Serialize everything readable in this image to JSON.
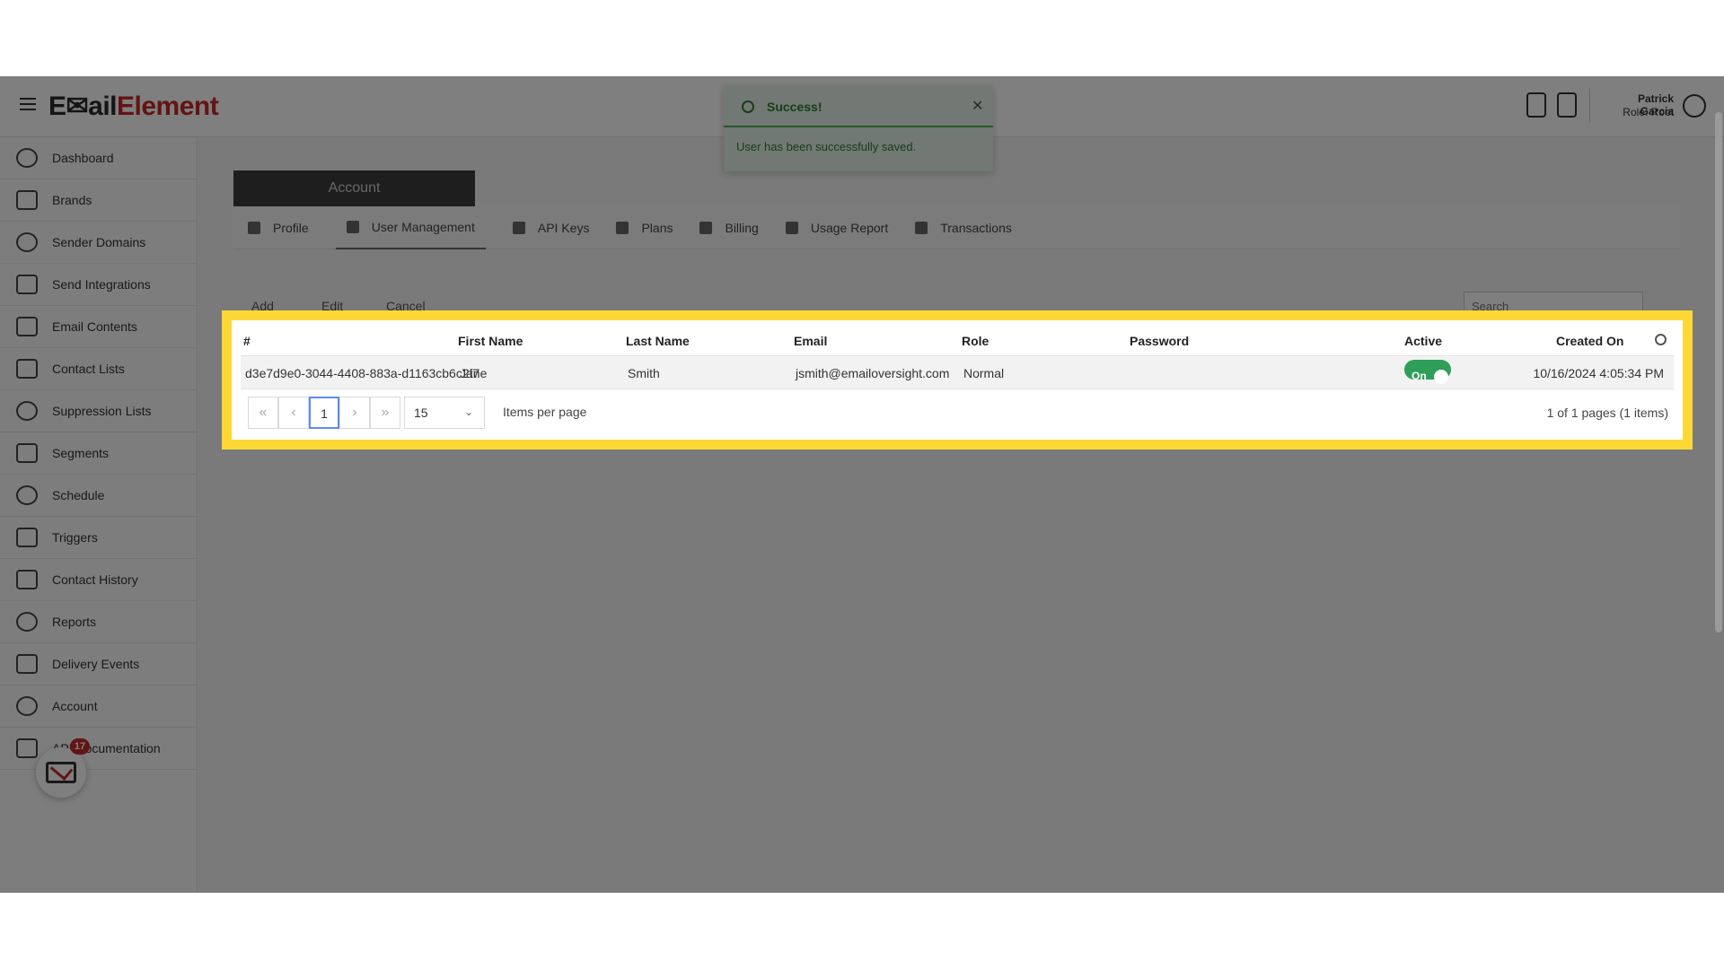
{
  "app": {
    "logo_part1": "E✉ail",
    "logo_part2": "Element"
  },
  "header": {
    "user_name": "Patrick Garcia",
    "user_role": "Role: Root"
  },
  "sidebar": {
    "items": [
      {
        "label": "Dashboard",
        "icon": "gauge-icon"
      },
      {
        "label": "Brands",
        "icon": "list-icon"
      },
      {
        "label": "Sender Domains",
        "icon": "globe-icon"
      },
      {
        "label": "Send Integrations",
        "icon": "plug-icon"
      },
      {
        "label": "Email Contents",
        "icon": "envelope-icon"
      },
      {
        "label": "Contact Lists",
        "icon": "contacts-icon"
      },
      {
        "label": "Suppression Lists",
        "icon": "alert-icon"
      },
      {
        "label": "Segments",
        "icon": "segments-icon"
      },
      {
        "label": "Schedule",
        "icon": "clock-icon"
      },
      {
        "label": "Triggers",
        "icon": "lightning-icon"
      },
      {
        "label": "Contact History",
        "icon": "clipboard-icon"
      },
      {
        "label": "Reports",
        "icon": "pie-icon"
      },
      {
        "label": "Delivery Events",
        "icon": "bar-chart-icon"
      },
      {
        "label": "Account",
        "icon": "user-circle-icon"
      },
      {
        "label": "API Documentation",
        "icon": "document-icon"
      }
    ],
    "notification_count": "17"
  },
  "account": {
    "header": "Account",
    "tabs": [
      {
        "label": "Profile"
      },
      {
        "label": "User Management"
      },
      {
        "label": "API Keys"
      },
      {
        "label": "Plans"
      },
      {
        "label": "Billing"
      },
      {
        "label": "Usage Report"
      },
      {
        "label": "Transactions"
      }
    ]
  },
  "toolbar": {
    "add": "Add",
    "edit": "Edit",
    "cancel": "Cancel",
    "search_placeholder": "Search"
  },
  "grid": {
    "columns": [
      "#",
      "First Name",
      "Last Name",
      "Email",
      "Role",
      "Password",
      "Active",
      "Created On"
    ],
    "rows": [
      {
        "id": "d3e7d9e0-3044-4408-883a-d1163cb6c2f7",
        "first_name": "Jane",
        "last_name": "Smith",
        "email": "jsmith@emailoversight.com",
        "role": "Normal",
        "password": "",
        "active": "On",
        "created_on": "10/16/2024 4:05:34 PM"
      }
    ],
    "pager": {
      "first": "«",
      "prev": "‹",
      "current_page": "1",
      "next": "›",
      "last": "»",
      "page_size": "15",
      "items_per_page_label": "Items per page",
      "page_info": "1 of 1 pages (1 items)"
    }
  },
  "toast": {
    "title": "Success!",
    "message": "User has been successfully saved.",
    "close": "✕"
  },
  "colors": {
    "highlight": "#fdd835",
    "toggle_on": "#2e9e58",
    "brand_red": "#c62828"
  }
}
